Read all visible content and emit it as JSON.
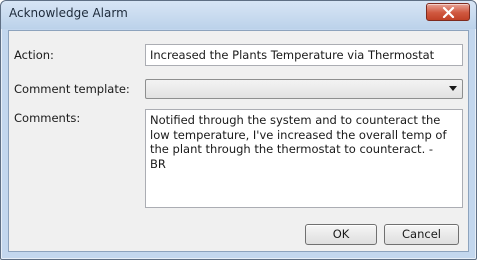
{
  "window": {
    "title": "Acknowledge Alarm"
  },
  "form": {
    "action_label": "Action:",
    "action_value": "Increased the Plants Temperature via Thermostat",
    "template_label": "Comment template:",
    "template_value": "",
    "comments_label": "Comments:",
    "comments_value": "Notified through the system and to counteract the low temperature, I've increased the overall temp of the plant through the thermostat to counteract. - BR"
  },
  "buttons": {
    "ok_label": "OK",
    "cancel_label": "Cancel"
  },
  "icons": {
    "close": "close-icon",
    "dropdown": "chevron-down-icon"
  },
  "colors": {
    "close_button": "#c8492f",
    "titlebar": "#c3d7ee"
  }
}
